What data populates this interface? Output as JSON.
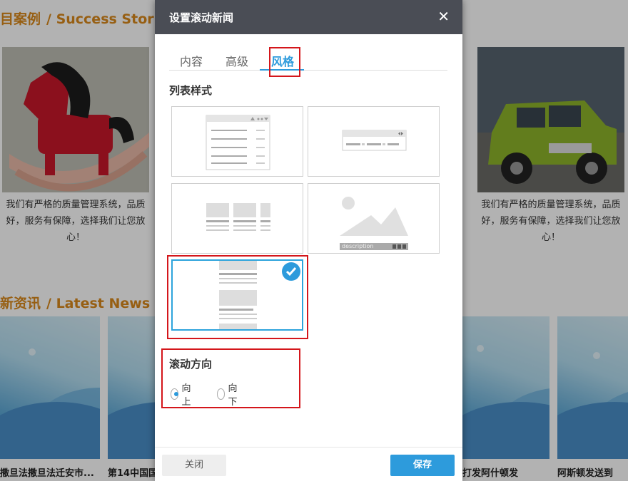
{
  "background": {
    "cases_title": "目案例",
    "cases_title_en": "/ Success Stories",
    "news_title": "新资讯",
    "news_title_en": "/ Latest News",
    "case_desc_left": "我们有严格的质量管理系统，品质好，服务有保障，选择我们让您放心！",
    "case_desc_right": "我们有严格的质量管理系统，品质好，服务有保障，选择我们让您放心！",
    "news_captions": [
      "撒旦法撒旦法迁安市...",
      "第14中国国",
      "打发阿什顿发",
      "阿斯顿发送到"
    ]
  },
  "dialog": {
    "title": "设置滚动新闻",
    "close_glyph": "✕",
    "tabs": [
      "内容",
      "高级",
      "风格"
    ],
    "active_tab": "风格",
    "list_style_label": "列表样式",
    "selected_style_index": 4,
    "style_thumb_caption": "description",
    "scroll_direction_label": "滚动方向",
    "directions": [
      "向上",
      "向下"
    ],
    "selected_direction": "向上",
    "close_button": "关闭",
    "save_button": "保存"
  },
  "colors": {
    "accent": "#2d9bdc",
    "header_bg": "#4a4d55",
    "highlight_red": "#d4161b",
    "section_title": "#d9891c"
  }
}
